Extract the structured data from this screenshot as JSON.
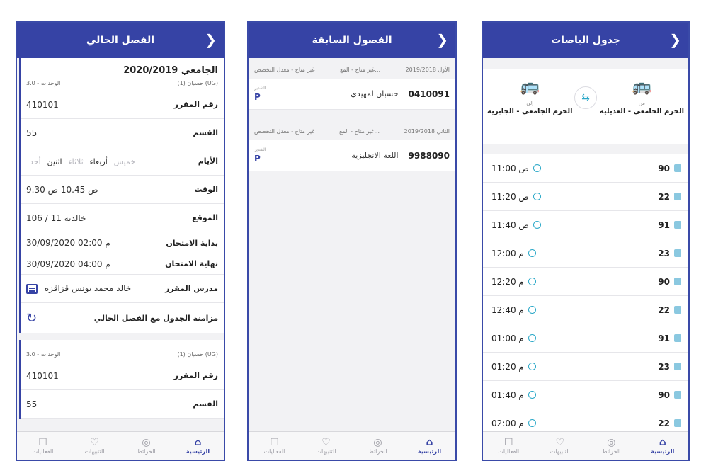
{
  "current": {
    "title": "الفصل الحالي",
    "section1": {
      "semester": "2020/2019 الجامعي",
      "course_name": "حسبان (1) (UG)",
      "units": "3.0 - الوحدات",
      "course_no_label": "رقم المقرر",
      "course_no": "410101",
      "section_label": "القسم",
      "section": "55",
      "days_label": "الأيام",
      "days": [
        "أحد",
        "اثنين",
        "ثلاثاء",
        "أربعاء",
        "خميس"
      ],
      "time_label": "الوقت",
      "time": "9.30 ص 10.45 ص",
      "location_label": "الموقع",
      "location": "خالديه 11 / 106",
      "exam_start_label": "بداية الامتحان",
      "exam_start": "30/09/2020 02:00 م",
      "exam_end_label": "نهاية الامتحان",
      "exam_end": "30/09/2020 04:00 م",
      "teacher_label": "مدرس المقرر",
      "teacher": "خالد محمد يونس قزاقزه",
      "sync_label": "مزامنة الجدول مع الفصل الحالي"
    },
    "section2": {
      "course_name": "حسبان (1) (UG)",
      "units": "3.0 - الوحدات",
      "course_no_label": "رقم المقرر",
      "course_no": "410101",
      "section_label": "القسم",
      "section": "55"
    }
  },
  "previous": {
    "title": "الفصول السابقة",
    "semesters": [
      {
        "term": "الأول 2019/2018",
        "status1": "غير متاح - المع...",
        "status2": "غير متاح - معدل التخصص",
        "grade_label": "التقدير",
        "grade": "P",
        "course_name": "حسبان لمهيدي",
        "code": "0410091"
      },
      {
        "term": "الثاني 2019/2018",
        "status1": "غير متاح - المع...",
        "status2": "غير متاح - معدل التخصص",
        "grade_label": "التقدير",
        "grade": "P",
        "course_name": "اللغة الانجليزية",
        "code": "9988090"
      }
    ]
  },
  "buses": {
    "title": "جدول الباصات",
    "from_label": "من",
    "from": "الحرم الجامعي - العديلية",
    "to_label": "إلى",
    "to": "الحرم الجامعي - الجابرية",
    "schedule": [
      {
        "bus": "90",
        "time": "11:00 ص"
      },
      {
        "bus": "22",
        "time": "11:20 ص"
      },
      {
        "bus": "91",
        "time": "11:40 ص"
      },
      {
        "bus": "23",
        "time": "12:00 م"
      },
      {
        "bus": "90",
        "time": "12:20 م"
      },
      {
        "bus": "22",
        "time": "12:40 م"
      },
      {
        "bus": "91",
        "time": "01:00 م"
      },
      {
        "bus": "23",
        "time": "01:20 م"
      },
      {
        "bus": "90",
        "time": "01:40 م"
      },
      {
        "bus": "22",
        "time": "02:00 م"
      }
    ]
  },
  "tabs": [
    {
      "label": "الرئيسية",
      "icon": "home-icon"
    },
    {
      "label": "الخرائط",
      "icon": "map-pin-icon"
    },
    {
      "label": "التنبيهات",
      "icon": "bell-icon"
    },
    {
      "label": "الفعاليات",
      "icon": "calendar-icon"
    }
  ],
  "colors": {
    "primary": "#3643a5",
    "accent": "#2aa8c8"
  }
}
